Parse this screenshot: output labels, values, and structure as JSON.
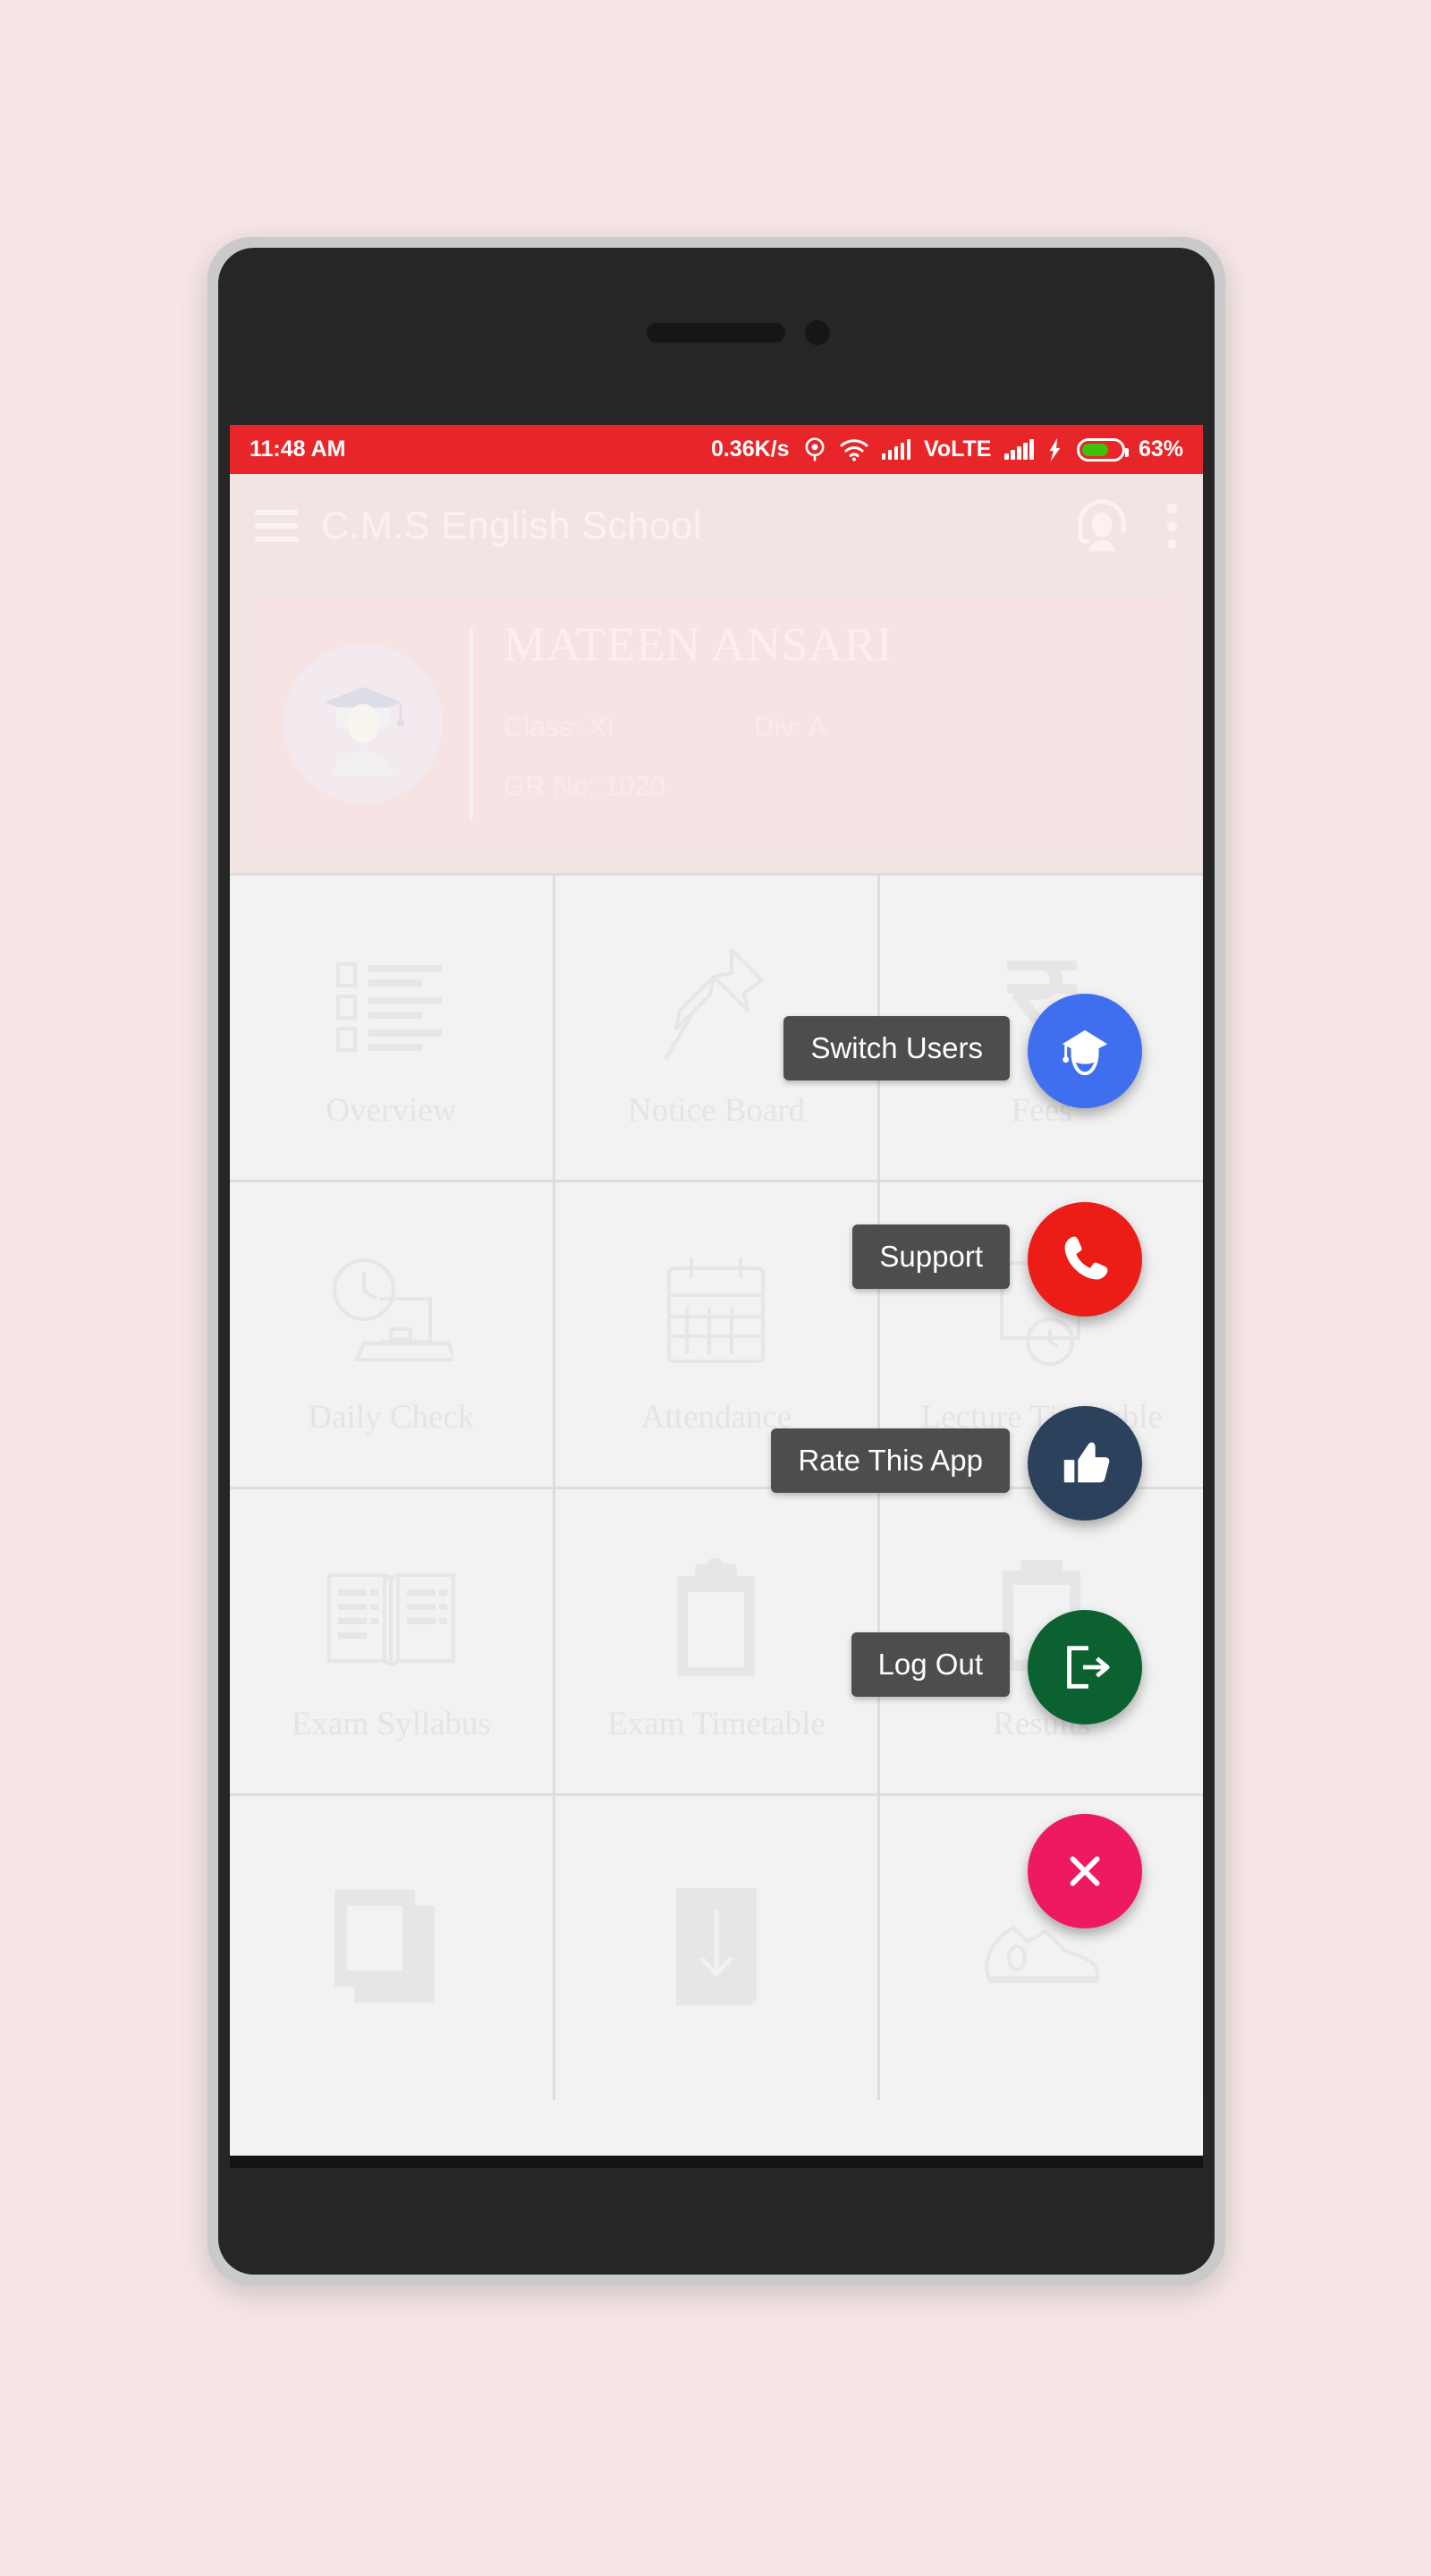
{
  "theme": {
    "page_background": "#f6e6e6",
    "bezel": "#cacaca",
    "phone_body": "#262626",
    "status_bar": "#e8262a",
    "app_bar": "#f3e4e4",
    "tile_background": "#f2f2f2",
    "label_chip": "#4d4d4d"
  },
  "status_bar": {
    "time": "11:48 AM",
    "network_speed": "0.36K/s",
    "location_icon": "location-icon",
    "wifi_icon": "wifi-icon",
    "signal_icon_1": "signal-bars-icon",
    "volte_label": "VoLTE",
    "signal_icon_2": "signal-bars-icon",
    "charging_icon": "charging-bolt-icon",
    "battery_icon": "battery-icon",
    "battery_percent": "63%",
    "battery_fill_color": "#3fc10a"
  },
  "app_bar": {
    "menu_icon": "hamburger-menu-icon",
    "title": "C.M.S English School",
    "support_icon": "support-agent-icon",
    "overflow_icon": "overflow-menu-icon"
  },
  "student_card": {
    "avatar_icon": "graduate-avatar-icon",
    "name": "MATEEN ANSARI",
    "class_label": "Class: XI",
    "div_label": "Div: A",
    "gr_no_label": "GR No: 1020"
  },
  "tiles": [
    {
      "label": "Overview",
      "icon": "list-overview-icon"
    },
    {
      "label": "Notice Board",
      "icon": "push-pin-icon"
    },
    {
      "label": "Fees",
      "icon": "rupee-icon"
    },
    {
      "label": "Daily Check",
      "icon": "clock-laptop-icon"
    },
    {
      "label": "Attendance",
      "icon": "calendar-icon"
    },
    {
      "label": "Lecture Timetable",
      "icon": "clock-document-icon"
    },
    {
      "label": "Exam Syllabus",
      "icon": "open-book-icon"
    },
    {
      "label": "Exam Timetable",
      "icon": "clipboard-icon"
    },
    {
      "label": "Results",
      "icon": "clipboard-result-icon"
    },
    {
      "label": "",
      "icon": "gallery-photos-icon"
    },
    {
      "label": "",
      "icon": "download-arrow-icon"
    },
    {
      "label": "",
      "icon": "sports-shoe-icon"
    }
  ],
  "speed_dial": {
    "items": [
      {
        "label": "Switch Users",
        "icon": "graduation-cap-icon",
        "color": "#3f6fee"
      },
      {
        "label": "Support",
        "icon": "phone-icon",
        "color": "#ec1c17"
      },
      {
        "label": "Rate This App",
        "icon": "thumbs-up-icon",
        "color": "#2c415c"
      },
      {
        "label": "Log Out",
        "icon": "logout-icon",
        "color": "#0c6130"
      }
    ],
    "close": {
      "icon": "close-x-icon",
      "color": "#ee1a5f"
    }
  }
}
